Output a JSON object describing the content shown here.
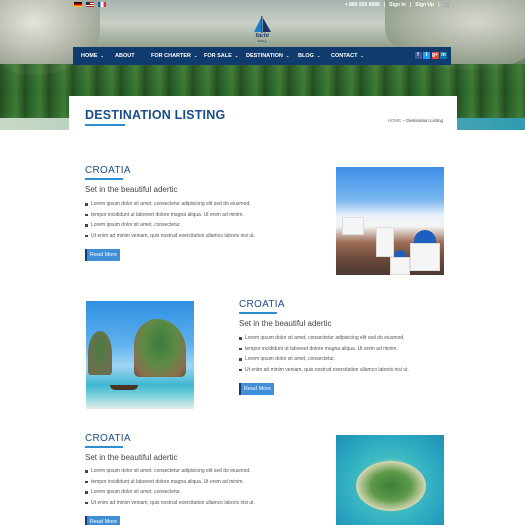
{
  "topbar": {
    "flags": [
      "flag-de-icon",
      "flag-us-icon",
      "flag-fr-icon"
    ],
    "phone": "+ 888 555 8888",
    "sign_in": "Sign In",
    "sign_up": "Sign Up",
    "separator": "|"
  },
  "logo": {
    "name": "Yacht",
    "tagline": "Sailing"
  },
  "nav": {
    "items": [
      {
        "label": "HOME",
        "dropdown": true
      },
      {
        "label": "ABOUT",
        "dropdown": false
      },
      {
        "label": "FOR CHARTER",
        "dropdown": true
      },
      {
        "label": "FOR SALE",
        "dropdown": true
      },
      {
        "label": "DESTINATION",
        "dropdown": true
      },
      {
        "label": "BLOG",
        "dropdown": true
      },
      {
        "label": "CONTACT",
        "dropdown": true
      }
    ],
    "social": [
      {
        "icon": "facebook-icon",
        "glyph": "f",
        "color": "#3b5998"
      },
      {
        "icon": "twitter-icon",
        "glyph": "t",
        "color": "#1da1f2"
      },
      {
        "icon": "google-plus-icon",
        "glyph": "g+",
        "color": "#dd4b39"
      },
      {
        "icon": "linkedin-icon",
        "glyph": "in",
        "color": "#0e76a8"
      }
    ]
  },
  "page": {
    "title": "DESTINATION LISTING",
    "breadcrumb": {
      "home": "HOME",
      "separator": "»",
      "current": "Destination Listing"
    }
  },
  "listings": [
    {
      "title": "CROATIA",
      "subtitle": "Set in the beautiful adertic",
      "bullets": [
        "Lorem ipsum dolor sit amet, consectetur adipisicing elit sed do eiusmod.",
        "tempor incididunt ut laboreet dolore magna aliqua. Ut enim ad minim.",
        "Lorem ipsum dolor sit amet, consectetur.",
        "Ut enim ad minim veniam, quis nostrud exercitation ullamco laboris nisi ut."
      ],
      "button": "Read More"
    },
    {
      "title": "CROATIA",
      "subtitle": "Set in the beautiful adertic",
      "bullets": [
        "Lorem ipsum dolor sit amet, consectetur adipisicing elit sed do eiusmod.",
        "tempor incididunt ut laboreet dolore magna aliqua. Ut enim ad minim.",
        "Lorem ipsum dolor sit amet, consectetur.",
        "Ut enim ad minim veniam, quis nostrud exercitation ullamco laboris nisi ut."
      ],
      "button": "Read More"
    },
    {
      "title": "CROATIA",
      "subtitle": "Set in the beautiful adertic",
      "bullets": [
        "Lorem ipsum dolor sit amet, consectetur adipisicing elit sed do eiusmod.",
        "tempor incididunt ut laboreet dolore magna aliqua. Ut enim ad minim.",
        "Lorem ipsum dolor sit amet, consectetur.",
        "Ut enim ad minim veniam, quis nostrud exercitation ullamco laboris nisi ut."
      ],
      "button": "Read More"
    }
  ],
  "colors": {
    "nav": "#0f3b6e",
    "accent": "#2c8dd1",
    "title": "#1a4e88",
    "button": "#3e8fd8"
  }
}
